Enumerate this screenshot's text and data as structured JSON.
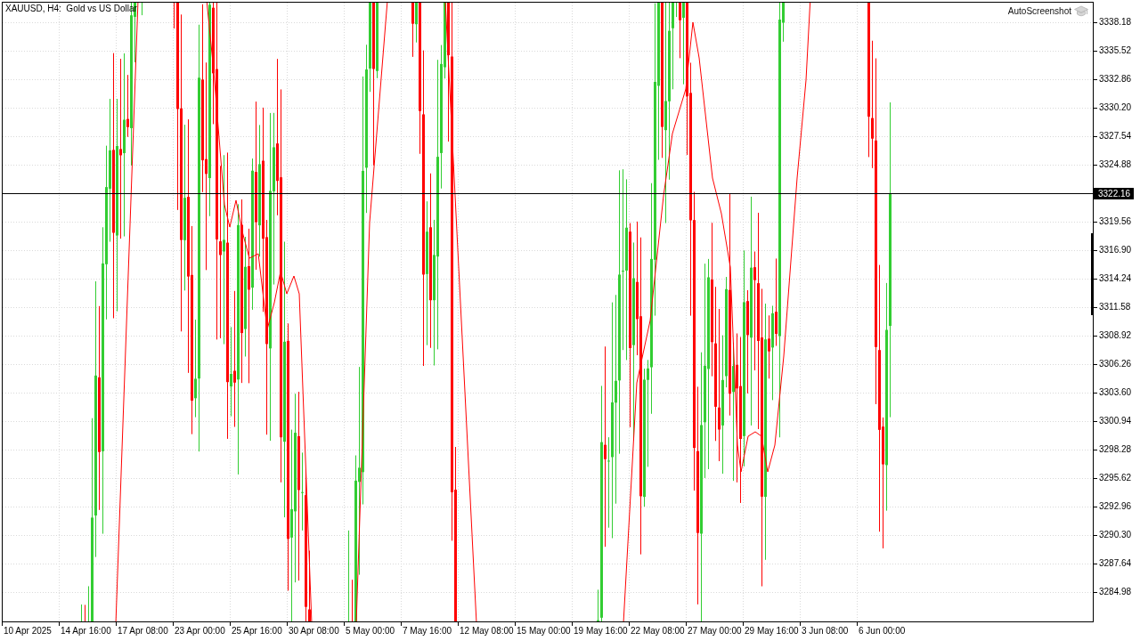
{
  "chart": {
    "title": "XAUUSD, H4:  Gold vs US Dollar",
    "overlay_label": "AutoScreenshot",
    "current_price": "3322.16",
    "price_axis": [
      "3338.18",
      "3335.52",
      "3332.86",
      "3330.20",
      "3327.54",
      "3324.88",
      "3319.56",
      "3316.90",
      "3314.24",
      "3311.58",
      "3308.92",
      "3306.26",
      "3303.60",
      "3300.94",
      "3298.28",
      "3295.62",
      "3292.96",
      "3290.30",
      "3287.64",
      "3284.98"
    ],
    "time_axis": [
      "10 Apr 2025",
      "14 Apr 16:00",
      "17 Apr 08:00",
      "23 Apr 00:00",
      "25 Apr 16:00",
      "30 Apr 08:00",
      "5 May 00:00",
      "7 May 16:00",
      "12 May 08:00",
      "15 May 00:00",
      "19 May 16:00",
      "22 May 08:00",
      "27 May 00:00",
      "29 May 16:00",
      "3 Jun 08:00",
      "6 Jun 00:00"
    ]
  }
}
